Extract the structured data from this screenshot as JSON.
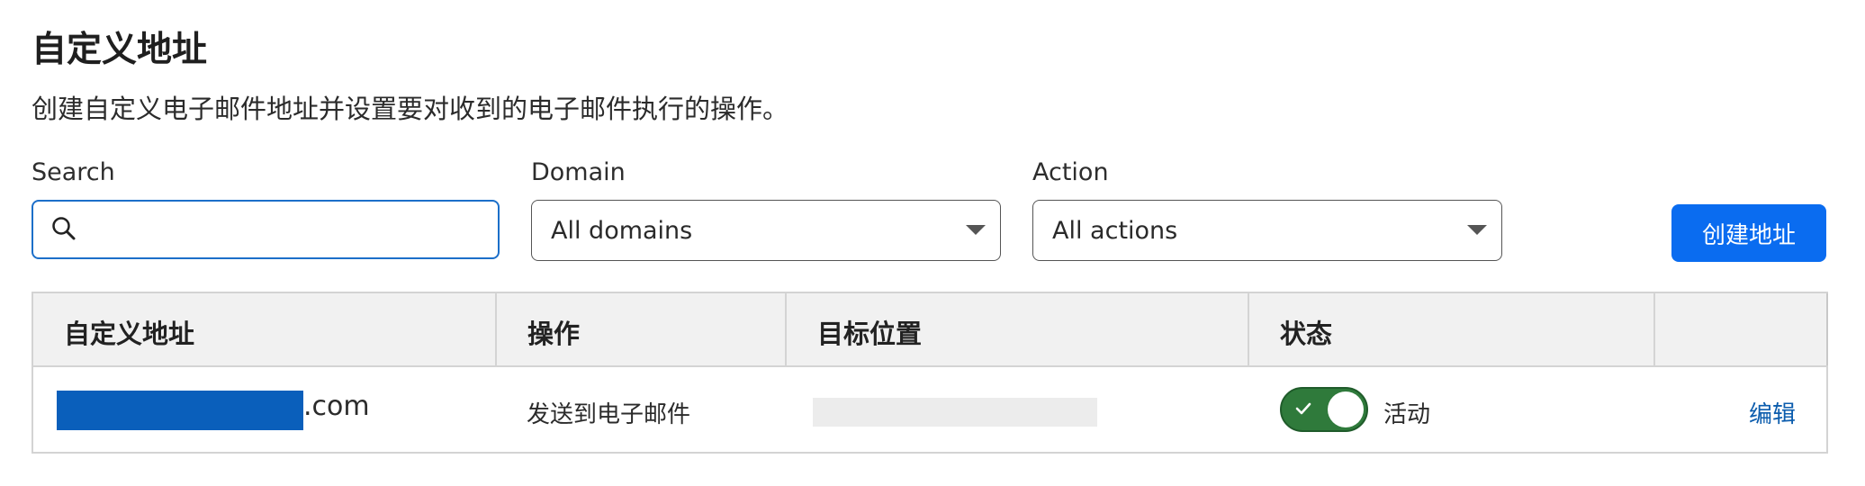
{
  "page": {
    "title": "自定义地址",
    "description": "创建自定义电子邮件地址并设置要对收到的电子邮件执行的操作。"
  },
  "filters": {
    "search": {
      "label": "Search",
      "value": "",
      "icon": "search-icon"
    },
    "domain": {
      "label": "Domain",
      "selected": "All domains"
    },
    "action": {
      "label": "Action",
      "selected": "All actions"
    }
  },
  "toolbar": {
    "create_label": "创建地址"
  },
  "table": {
    "columns": [
      "自定义地址",
      "操作",
      "目标位置",
      "状态",
      ""
    ],
    "rows": [
      {
        "address_suffix": ".com",
        "action": "发送到电子邮件",
        "status": "活动",
        "edit_label": "编辑"
      }
    ]
  },
  "colors": {
    "primary": "#0a6cf0",
    "focus_border": "#1c6fc9",
    "toggle_on": "#2f7a3b",
    "link": "#0b5cad",
    "header_bg": "#f1f1f1",
    "redaction": "#0a5fbb"
  }
}
